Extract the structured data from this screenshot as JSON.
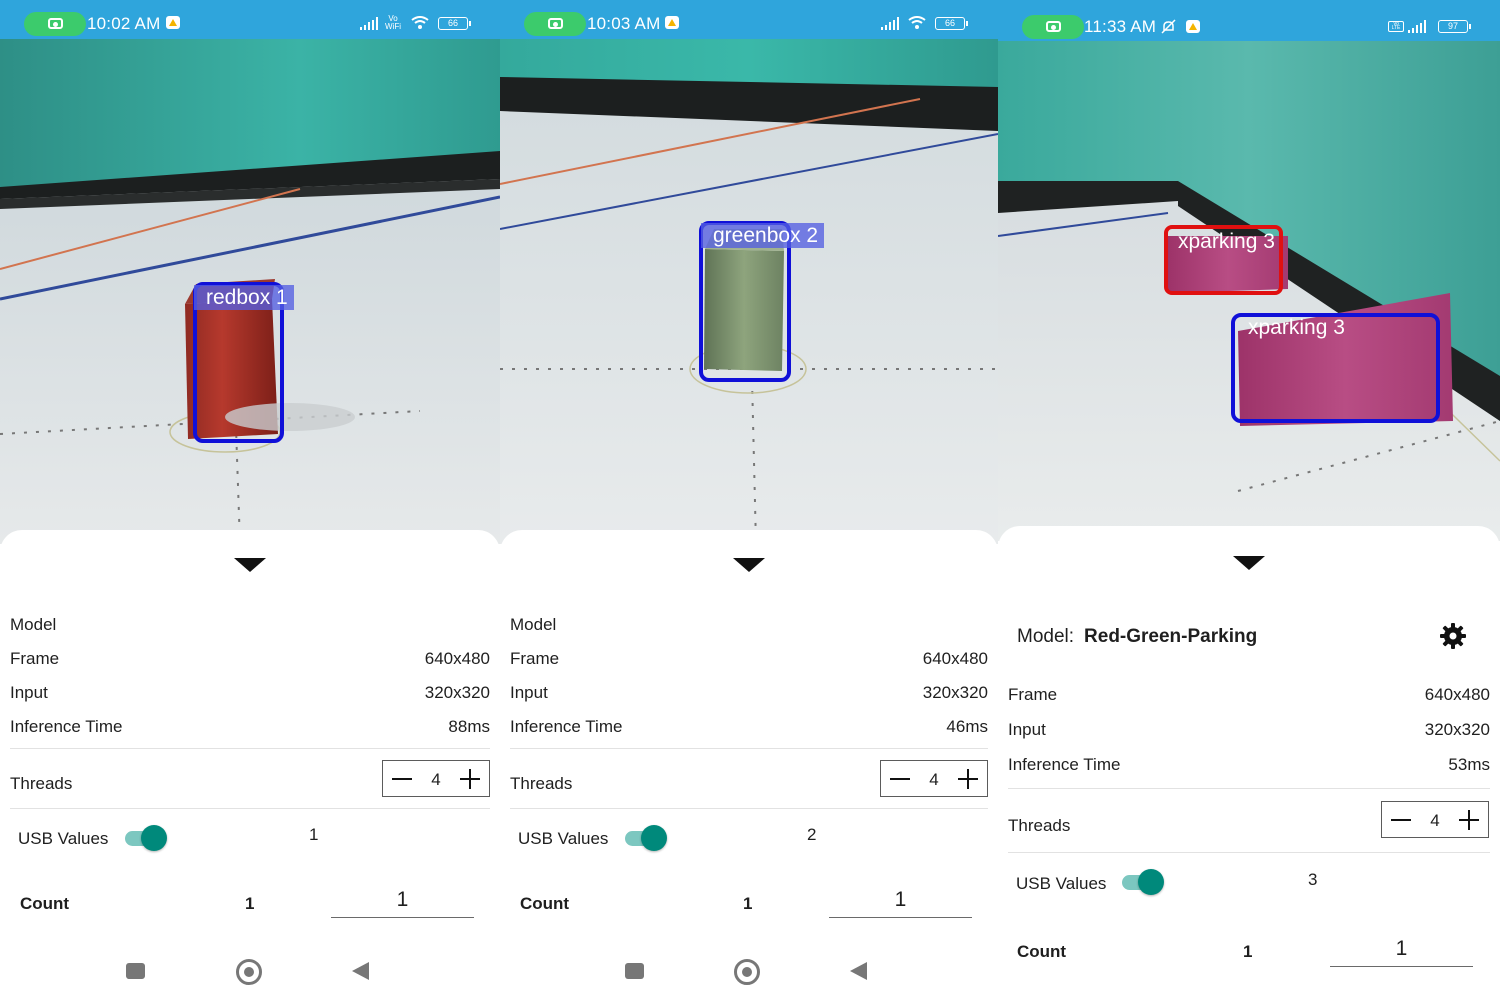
{
  "panels": [
    {
      "status": {
        "time": "10:02 AM",
        "vowifi_top": "Vo",
        "vowifi_bottom": "WiFi",
        "battery": "66"
      },
      "detection": {
        "label": "redbox 1",
        "color": "#1010d8"
      },
      "info": {
        "model_label": "Model",
        "frame_label": "Frame",
        "frame_value": "640x480",
        "input_label": "Input",
        "input_value": "320x320",
        "inference_label": "Inference Time",
        "inference_value": "88ms",
        "threads_label": "Threads",
        "threads_value": "4",
        "usb_label": "USB Values",
        "usb_value": "1",
        "count_label": "Count",
        "count_value": "1",
        "count_input": "1"
      }
    },
    {
      "status": {
        "time": "10:03 AM",
        "battery": "66"
      },
      "detection": {
        "label": "greenbox 2",
        "color": "#1010d8"
      },
      "info": {
        "model_label": "Model",
        "frame_label": "Frame",
        "frame_value": "640x480",
        "input_label": "Input",
        "input_value": "320x320",
        "inference_label": "Inference Time",
        "inference_value": "46ms",
        "threads_label": "Threads",
        "threads_value": "4",
        "usb_label": "USB Values",
        "usb_value": "2",
        "count_label": "Count",
        "count_value": "1",
        "count_input": "1"
      }
    },
    {
      "status": {
        "time": "11:33 AM",
        "volte": "Vo LTE",
        "battery": "97"
      },
      "detections": [
        {
          "label": "xparking 3",
          "color": "#e01010"
        },
        {
          "label": "xparking 3",
          "color": "#1010d8"
        }
      ],
      "info": {
        "model_label": "Model:",
        "model_value": "Red-Green-Parking",
        "frame_label": "Frame",
        "frame_value": "640x480",
        "input_label": "Input",
        "input_value": "320x320",
        "inference_label": "Inference Time",
        "inference_value": "53ms",
        "threads_label": "Threads",
        "threads_value": "4",
        "usb_label": "USB Values",
        "usb_value": "3",
        "count_label": "Count",
        "count_value": "1",
        "count_input": "1"
      }
    }
  ],
  "icons": {
    "camera": "camera-icon",
    "gdrive": "google-drive-icon",
    "signal": "signal-icon",
    "wifi": "wifi-icon",
    "battery": "battery-icon",
    "mute": "bell-off-icon",
    "collapse": "chevron-down-icon",
    "settings": "gear-icon",
    "nav_recents": "square-icon",
    "nav_home": "circle-icon",
    "nav_back": "triangle-back-icon"
  },
  "colors": {
    "status_bar": "#2fa5dc",
    "recording_pill": "#3ccb6c",
    "toggle_on": "#00897b",
    "wall": "#36b5a5"
  }
}
